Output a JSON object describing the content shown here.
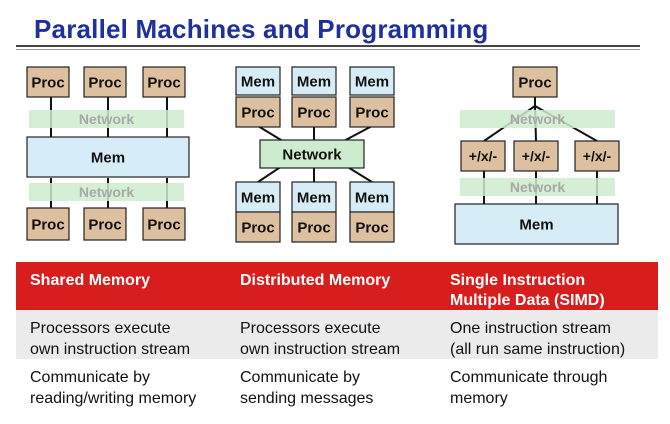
{
  "title": "Parallel Machines and Programming",
  "colors": {
    "title": "#1f2f9c",
    "header_bg": "#d81d1d",
    "proc_box": "#dcc0a0",
    "mem_box": "#d6ecf6",
    "network_box": "#cdeccd",
    "alt_row": "#ebebeb"
  },
  "diagrams": {
    "shared": {
      "proc": "Proc",
      "network": "Network",
      "mem": "Mem"
    },
    "distributed": {
      "mem": "Mem",
      "proc": "Proc",
      "network": "Network"
    },
    "simd": {
      "proc": "Proc",
      "network": "Network",
      "alu": "+/x/-",
      "mem": "Mem"
    }
  },
  "table": {
    "headers": [
      "Shared Memory",
      "Distributed Memory",
      "Single Instruction\nMultiple Data (SIMD)"
    ],
    "rows": [
      [
        "Processors execute\nown instruction stream",
        "Processors execute\nown instruction stream",
        "One instruction stream\n(all run same instruction)"
      ],
      [
        "Communicate by\nreading/writing memory",
        "Communicate by\nsending messages",
        "Communicate through\nmemory"
      ]
    ]
  }
}
